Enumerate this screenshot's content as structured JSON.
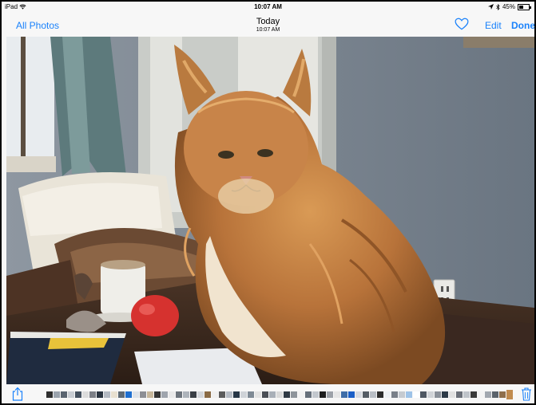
{
  "status_bar": {
    "device": "iPad",
    "wifi_icon": "wifi-icon",
    "time": "10:07 AM",
    "battery": "45%",
    "location_icon": "location-arrow-icon",
    "bluetooth_icon": "bluetooth-icon"
  },
  "nav": {
    "back_label": "All Photos",
    "title": "Today",
    "subtitle": "10:07 AM",
    "favorite_icon": "heart-icon",
    "edit_label": "Edit",
    "done_label": "Done",
    "accent": "#1a82fb"
  },
  "photo": {
    "subject": "cat-photo"
  },
  "toolbar": {
    "share_icon": "share-icon",
    "trash_icon": "trash-icon"
  },
  "thumbnails": [
    "#2f2f2f",
    "#9aa3ad",
    "#5a6470",
    "#c9cdd3",
    "#44505e",
    "#dcdcdc",
    "#7c7f86",
    "#2a3440",
    "#b3b9c2",
    "#e8e0d0",
    "#5f6b76",
    "#1f6fd0",
    "#dfe3e8",
    "#8d8f95",
    "#c7b79c",
    "#343434",
    "#9fa5ad",
    "#e9e9e9",
    "#6d747c",
    "#aeb4bb",
    "#3a3f46",
    "#d3d6da",
    "#8a6b45",
    "#f0f0f0",
    "#5c5c5c",
    "#b6bcc4",
    "#273747",
    "#cfd3d8",
    "#7f8a95",
    "#e3e3e3",
    "#4a4f56",
    "#a9b0b8",
    "#dadada",
    "#303a45",
    "#8e949b",
    "#f2f2f2",
    "#66707b",
    "#c2c7cd",
    "#1e1e1e",
    "#9da2a9",
    "#e6e6e6",
    "#3f6ea8",
    "#1b5fc7",
    "#d8dbe0",
    "#565d65",
    "#b9bec5",
    "#2c2c2c",
    "#edf0f3",
    "#7a8089",
    "#c5cad0",
    "#9ec3e8",
    "#ffffff",
    "#4f5863",
    "#d0d3d7",
    "#8a9099",
    "#2d3a48",
    "#e1e1e1",
    "#6b7079",
    "#bfc4ca",
    "#3b3b3b",
    "#f4f4f4",
    "#a2a8b0",
    "#5b636c",
    "#8f6f4c",
    "#c08b4f"
  ]
}
